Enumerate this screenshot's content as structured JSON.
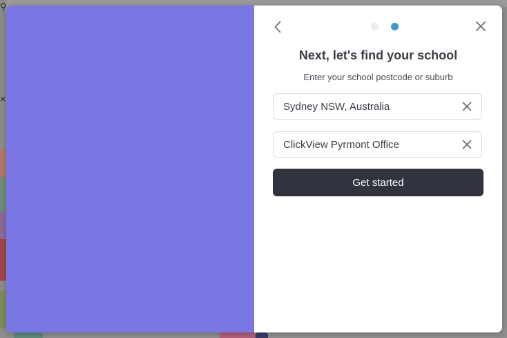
{
  "modal": {
    "title": "Next, let's find your school",
    "subtitle": "Enter your school postcode or suburb",
    "steps": {
      "total": 2,
      "current": 2
    },
    "location_field": {
      "value": "Sydney NSW, Australia"
    },
    "school_field": {
      "value": "ClickView Pyrmont Office"
    },
    "cta_label": "Get started"
  },
  "icons": {
    "back": "chevron-left-icon",
    "close": "close-icon",
    "clear": "close-icon"
  },
  "colors": {
    "illustration_bg": "#7a76e3",
    "primary_button": "#31343f",
    "active_step": "#3d99c9",
    "inactive_step": "#eeeeee",
    "heading_text": "#3a3d46"
  }
}
